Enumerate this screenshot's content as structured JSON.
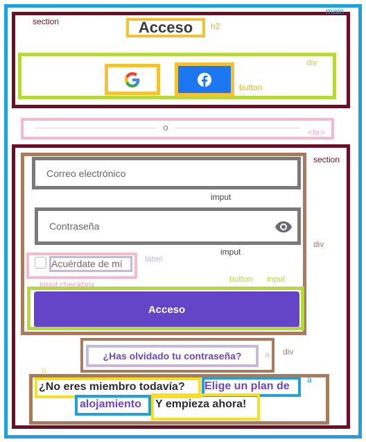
{
  "labels": {
    "main": "main",
    "section_top": "section",
    "h2": "h2",
    "div_social": "div",
    "button_social": "button",
    "hr": "<hr>",
    "section_form": "section",
    "input_email": "imput",
    "input_password": "imput",
    "div_form": "div",
    "label": "label",
    "input_checkbox": "input checkbox",
    "button_submit": "button",
    "input_submit": "input",
    "div_forgot": "div",
    "a_forgot": "a",
    "p": "p",
    "a_plan": "a"
  },
  "content": {
    "title": "Acceso",
    "divider_text": "o",
    "email_placeholder": "Correo electrónico",
    "password_placeholder": "Contraseña",
    "remember_label": "Acuérdate de mí",
    "submit_label": "Acceso",
    "forgot_link": "¿Has olvidado tu contraseña?",
    "not_member": "¿No eres miembro todavía?",
    "plan_link_part1": "Elige un plan de",
    "plan_link_part2": "alojamiento",
    "start_now": "Y empieza ahora!"
  },
  "icons": {
    "google": "google-logo-icon",
    "facebook": "facebook-logo-icon",
    "eye": "eye-icon"
  },
  "colors": {
    "main_outline": "#1ea1dc",
    "section_outline": "#6e0d25",
    "heading_outline": "#f2c230",
    "div_outline": "#b5d93a",
    "hr_outline": "#f4b8cf",
    "form_div_outline": "#a97a5c",
    "input_outline": "#7a7a7a",
    "link_outline": "#c5b8dd",
    "span_outline": "#f5e020",
    "facebook_blue": "#1b78f2",
    "submit_purple": "#6445c8",
    "link_purple": "#6b45c9"
  }
}
